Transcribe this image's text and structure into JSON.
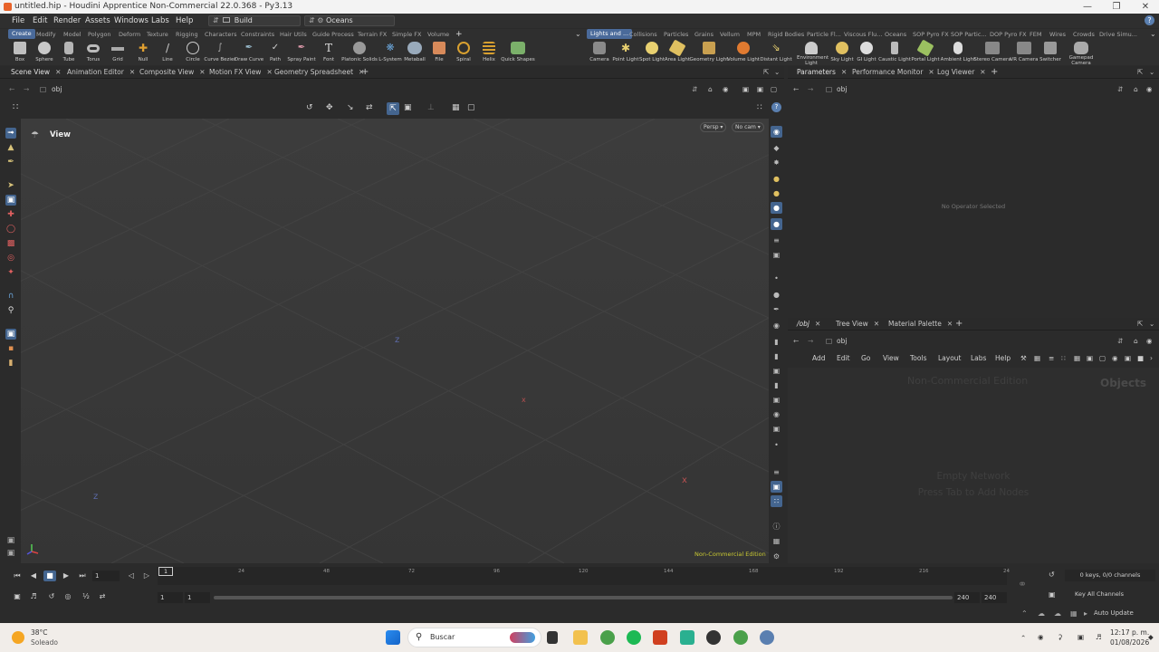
{
  "window": {
    "title": "untitled.hip - Houdini Apprentice Non-Commercial 22.0.368 - Py3.13",
    "controls": [
      "—",
      "❐",
      "✕"
    ]
  },
  "menubar": {
    "items": [
      "File",
      "Edit",
      "Render",
      "Assets",
      "Windows",
      "Labs",
      "Help"
    ],
    "desktop": "Build",
    "context": "Oceans",
    "help_icon": "?"
  },
  "shelf_left": {
    "tabs": [
      "Create",
      "Modify",
      "Model",
      "Polygon",
      "Deform",
      "Texture",
      "Rigging",
      "Characters",
      "Constraints",
      "Hair Utils",
      "Guide Process",
      "Terrain FX",
      "Simple FX",
      "Volume"
    ],
    "tools": [
      "Box",
      "Sphere",
      "Tube",
      "Torus",
      "Grid",
      "Null",
      "Line",
      "Circle",
      "Curve Bezier",
      "Draw Curve",
      "Path",
      "Spray Paint",
      "Font",
      "Platonic Solids",
      "L-System",
      "Metaball",
      "File",
      "Spiral",
      "Helix",
      "Quick Shapes"
    ]
  },
  "shelf_right": {
    "tabs": [
      "Lights and ...",
      "Collisions",
      "Particles",
      "Grains",
      "Vellum",
      "MPM",
      "Rigid Bodies",
      "Particle Fl...",
      "Viscous Flu...",
      "Oceans",
      "SOP Pyro FX",
      "SOP Partic...",
      "DOP Pyro FX",
      "FEM",
      "Wires",
      "Crowds",
      "Drive Simu..."
    ],
    "tools": [
      "Camera",
      "Point Light",
      "Spot Light",
      "Area Light",
      "Geometry Light",
      "Volume Light",
      "Distant Light",
      "Environment Light",
      "Sky Light",
      "GI Light",
      "Caustic Light",
      "Portal Light",
      "Ambient Light",
      "Stereo Camera",
      "VR Camera",
      "Switcher",
      "Gamepad Camera"
    ]
  },
  "left_pane": {
    "tabs": [
      "Scene View",
      "Animation Editor",
      "Composite View",
      "Motion FX View",
      "Geometry Spreadsheet"
    ],
    "path": "obj",
    "viewport": {
      "view_label": "View",
      "persp": "Persp ▾",
      "cam": "No cam ▾",
      "edition": "Non-Commercial Edition"
    }
  },
  "params_pane": {
    "tabs": [
      "Parameters",
      "Performance Monitor",
      "Log Viewer"
    ],
    "path": "obj",
    "empty_text": "No Operator Selected"
  },
  "network_pane": {
    "tabs": [
      "/obj",
      "Tree View",
      "Material Palette"
    ],
    "path": "obj",
    "menu": [
      "Add",
      "Edit",
      "Go",
      "View",
      "Tools",
      "Layout",
      "Labs",
      "Help"
    ],
    "edition": "Non-Commercial Edition",
    "context_label": "Objects",
    "empty_title": "Empty Network",
    "empty_hint": "Press Tab to Add Nodes"
  },
  "timeline": {
    "frame": "1",
    "current_frame_marker": "1",
    "ticks": [
      "24",
      "48",
      "72",
      "96",
      "120",
      "144",
      "168",
      "192",
      "216",
      "24"
    ],
    "range_start": "1",
    "range_start2": "1",
    "range_end": "240",
    "range_end2": "240",
    "keys_status": "0 keys, 0/0 channels",
    "key_all": "Key All Channels",
    "auto_update": "Auto Update"
  },
  "taskbar": {
    "weather_temp": "38°C",
    "weather_desc": "Soleado",
    "search_placeholder": "Buscar",
    "time": "12:17 p. m.",
    "date": "01/08/2026"
  }
}
